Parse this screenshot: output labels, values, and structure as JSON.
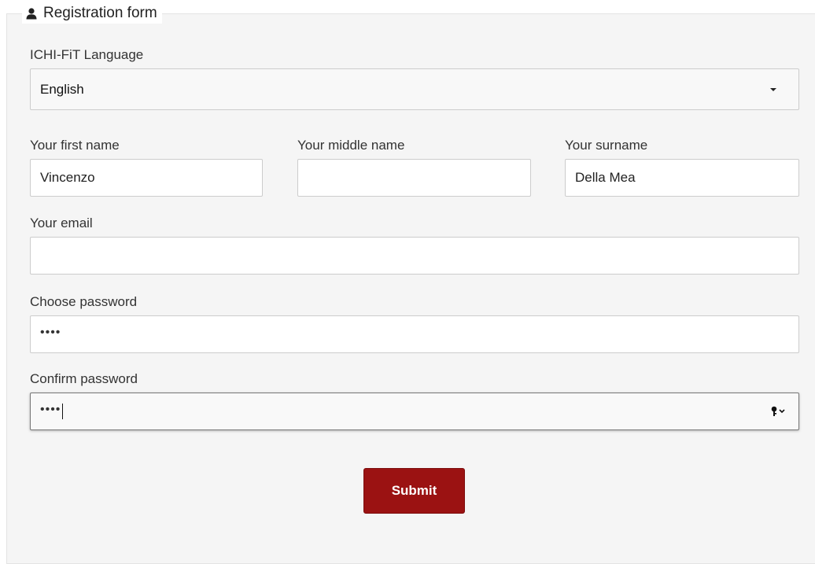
{
  "form": {
    "legend": "Registration form",
    "legend_icon": "user-icon"
  },
  "language": {
    "label": "ICHI-FiT Language",
    "selected": "English"
  },
  "first_name": {
    "label": "Your first name",
    "value": "Vincenzo"
  },
  "middle_name": {
    "label": "Your middle name",
    "value": ""
  },
  "surname": {
    "label": "Your surname",
    "value": "Della Mea"
  },
  "email": {
    "label": "Your email",
    "value": ""
  },
  "password": {
    "label": "Choose password",
    "masked_value": "••••"
  },
  "confirm_password": {
    "label": "Confirm password",
    "masked_value": "••••",
    "key_icon": "key-icon"
  },
  "submit": {
    "label": "Submit",
    "color": "#9b1212"
  }
}
